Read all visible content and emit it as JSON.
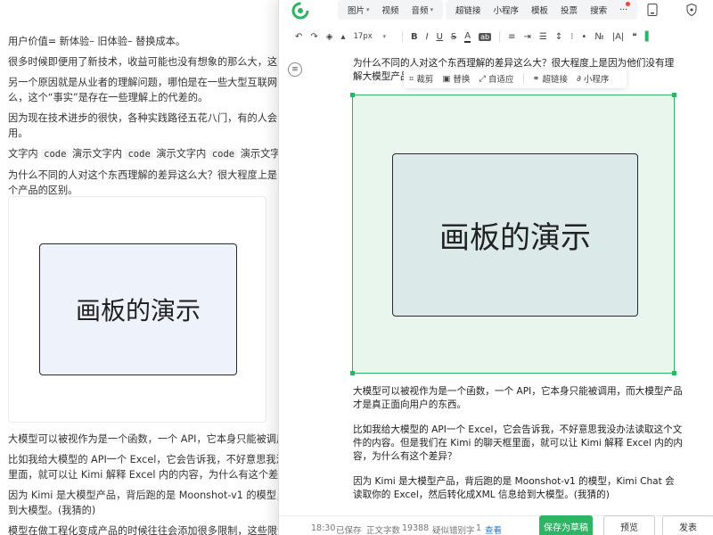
{
  "left_doc": {
    "lines": [
      "用户价值= 新体验– 旧体验– 替换成本。",
      "很多时候即便用了新技术，收益可能也没有想象的那么大，这是一个",
      "另一个原因就是从业者的理解问题，哪怕是在一些大型互联网公司内",
      "么，这个“事实”是存在一些理解上的代差的。",
      "因为现在技术进步的很快，各种实践路径五花八门，有的人会觉得这",
      "用。"
    ],
    "code_line": {
      "t1": "文字内 ",
      "code": "code",
      "t2": " 演示文字内 ",
      "t3": " 演示文字内 ",
      "t4": " 演示文字内 "
    },
    "question_line1": "为什么不同的人对这个东西理解的差异这么大？很大程度上是因为他",
    "question_line2": "个产品的区别。",
    "board_text": "画板的演示",
    "lower_lines": [
      "大模型可以被视作为是一个函数，一个 API，它本身只能被调用，而大",
      "比如我给大模型的 API一个 Excel，它会告诉我，不好意思我没办法读",
      "里面，就可以让 Kimi 解释 Excel 内的内容，为什么有这个差异？",
      "因为 Kimi 是大模型产品，背后跑的是 Moonshot-v1 的模型，Kimi Ch",
      "到大模型。(我猜的)",
      "模型在做工程化变成产品的时候往往会添加很多限制，这些限制可能"
    ]
  },
  "toolbar": {
    "group1": [
      "图片",
      "视频",
      "音频"
    ],
    "group2": [
      "超链接",
      "小程序",
      "模板",
      "投票",
      "搜索",
      "···"
    ]
  },
  "format": {
    "font_size": "17px",
    "buttons": [
      "B",
      "I",
      "U",
      "S",
      "A"
    ]
  },
  "image_toolbar": {
    "crop": "裁剪",
    "replace": "替换",
    "fit": "自适应",
    "link": "超链接",
    "mini": "小程序"
  },
  "editor": {
    "heading": "为什么不同的人对这个东西理解的差异这么大？很大程度上是因为他们没有理解大模型产品作为一个产品的区别。",
    "board_text": "画板的演示",
    "paragraphs": [
      "大模型可以被视作为是一个函数，一个 API，它本身只能被调用，而大模型产品才是真正面向用户的东西。",
      "比如我给大模型的 API一个 Excel，它会告诉我，不好意思我没办法读取这个文件的内容。但是我们在 Kimi 的聊天框里面，就可以让 Kimi 解释 Excel 内的内容，为什么有这个差异？",
      "因为 Kimi 是大模型产品，背后跑的是 Moonshot-v1 的模型，Kimi Chat 会读取你的 Excel，然后转化成XML 信息给到大模型。(我猜的)"
    ]
  },
  "footer": {
    "time": "18:30",
    "saved": "已保存",
    "word_label": "正文字数",
    "word_count": "19388",
    "typo_label": "疑似错别字",
    "typo_count": "1",
    "view": "查看",
    "save_draft": "保存为草稿",
    "preview": "预览",
    "publish": "发表"
  },
  "colors": {
    "accent_green": "#2db464",
    "image_bg": "#e8f6ee"
  }
}
